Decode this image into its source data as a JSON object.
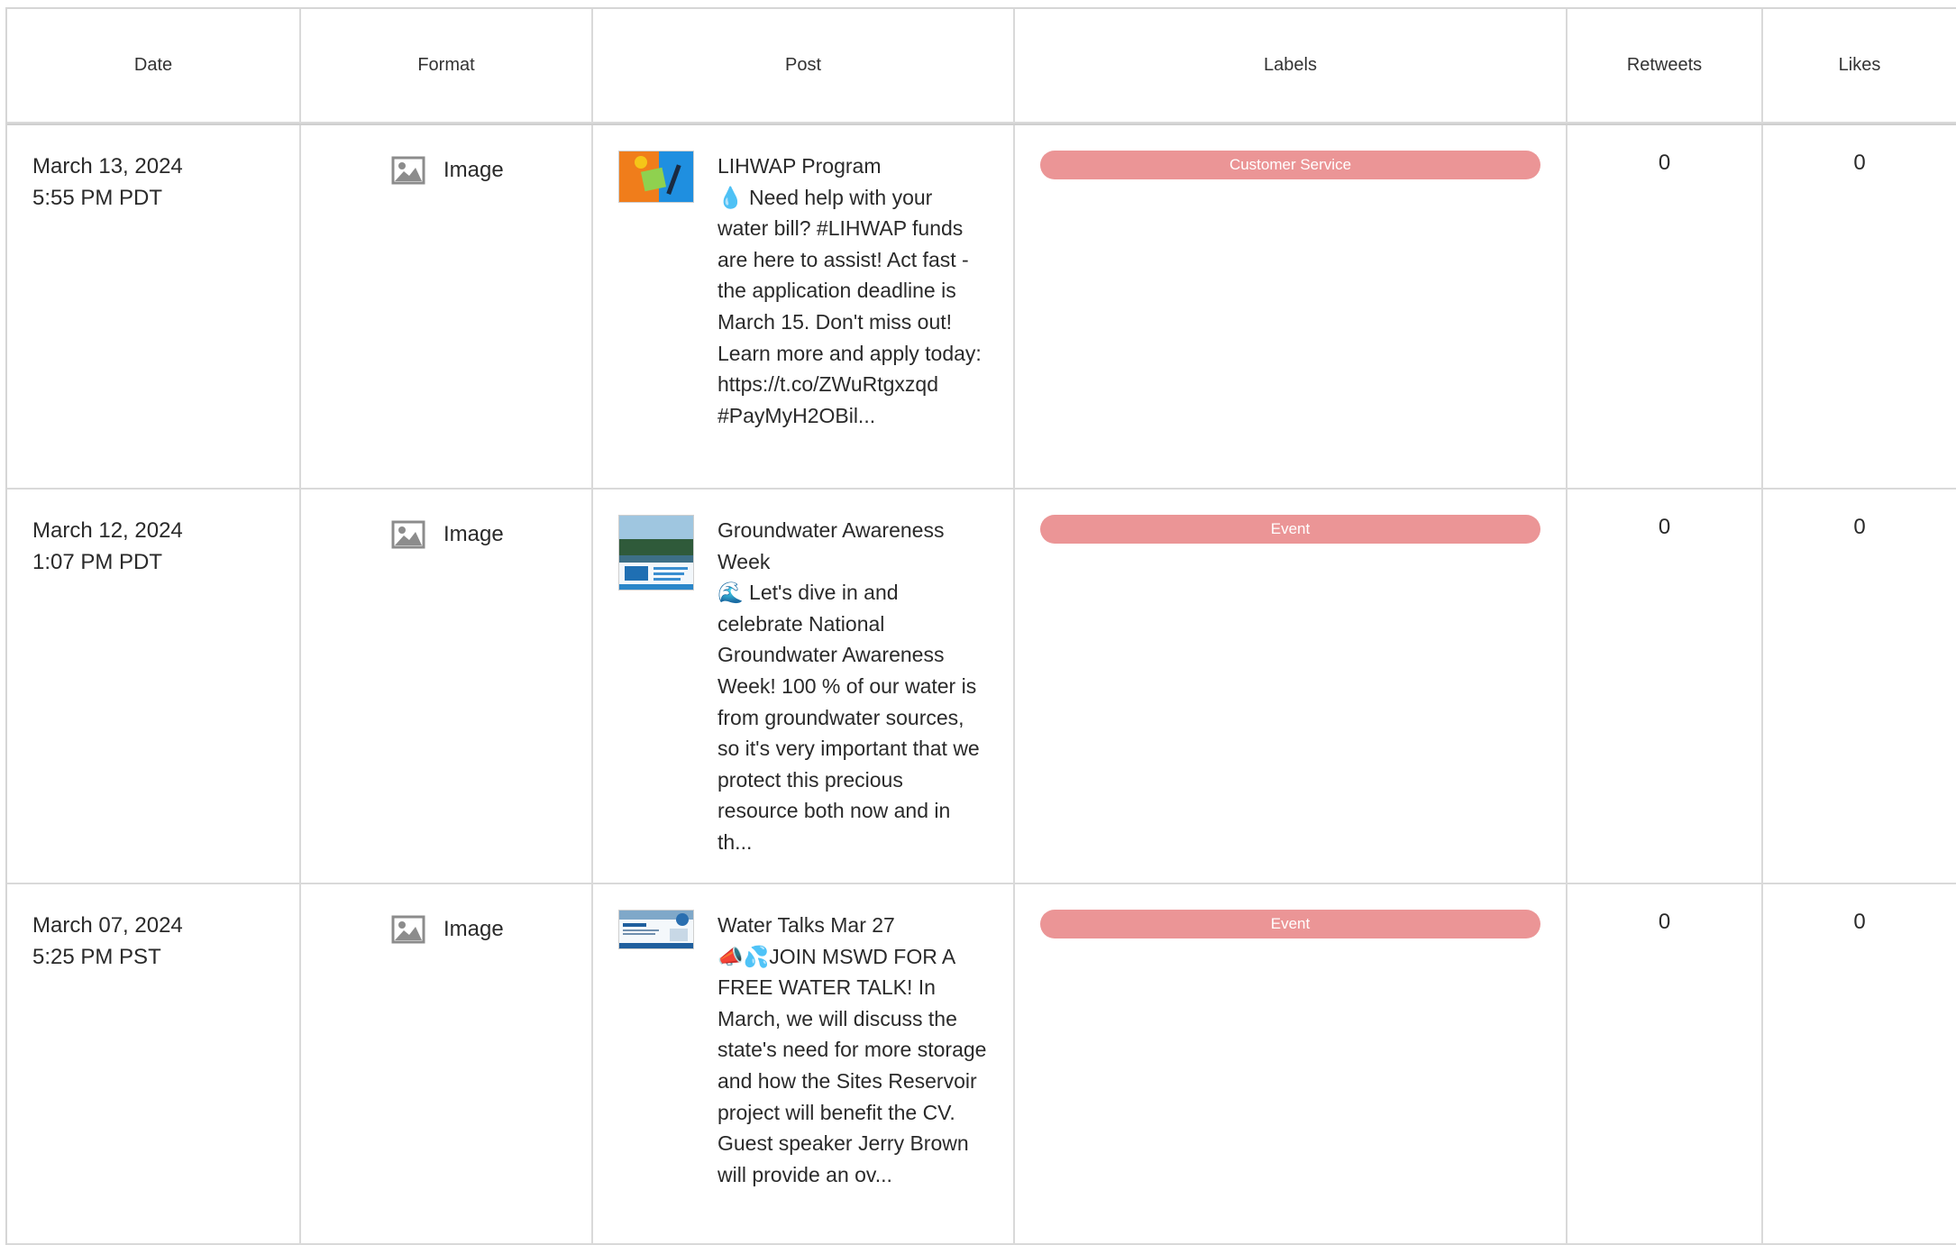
{
  "header": {
    "date": "Date",
    "format": "Format",
    "post": "Post",
    "labels": "Labels",
    "retweets": "Retweets",
    "likes": "Likes"
  },
  "colors": {
    "label_pill": "#eb9596",
    "border": "#d9d9d9"
  },
  "rows": [
    {
      "date": "March 13, 2024",
      "time": "5:55 PM PDT",
      "format_icon": "image-icon",
      "format": "Image",
      "post_title": "LIHWAP Program",
      "post_body": "💧 Need help with your water bill? #LIHWAP funds are here to assist! Act fast - the application deadline is March 15. Don't miss out! Learn more and apply today: https://t.co/ZWuRtgxzqd #PayMyH2OBil...",
      "label": "Customer Service",
      "retweets": "0",
      "likes": "0"
    },
    {
      "date": "March 12, 2024",
      "time": "1:07 PM PDT",
      "format_icon": "image-icon",
      "format": "Image",
      "post_title": "Groundwater Awareness Week",
      "post_body": "🌊 Let's dive in and celebrate National Groundwater Awareness Week! 100 % of our water is from groundwater sources, so it's very important that we protect this precious resource both now and in th...",
      "label": "Event",
      "retweets": "0",
      "likes": "0"
    },
    {
      "date": "March 07, 2024",
      "time": "5:25 PM PST",
      "format_icon": "image-icon",
      "format": "Image",
      "post_title": "Water Talks Mar 27",
      "post_body": "📣💦JOIN MSWD FOR A FREE WATER TALK! In March, we will discuss the state's need for more storage and how the Sites Reservoir project will benefit the CV. Guest speaker Jerry Brown will provide an ov...",
      "label": "Event",
      "retweets": "0",
      "likes": "0"
    }
  ]
}
